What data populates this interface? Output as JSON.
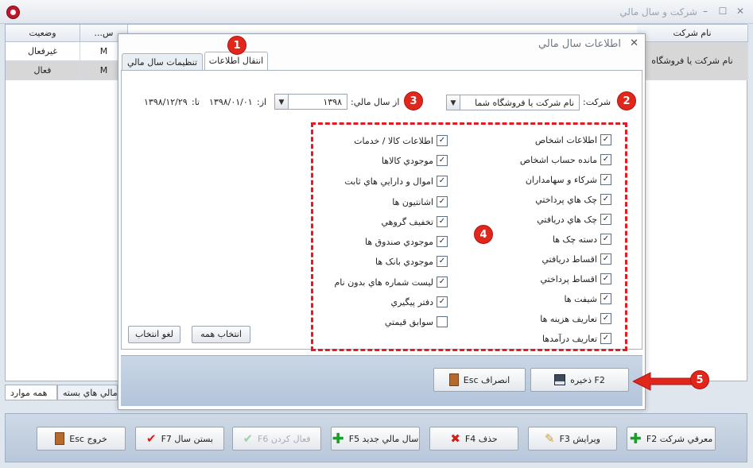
{
  "window": {
    "title": "شرکت و سال مالي"
  },
  "bg_table": {
    "headers": [
      "وضعيت",
      "...س",
      "نام شرکت"
    ],
    "rows": [
      {
        "status": "غيرفعال",
        "code": "M",
        "company": "نام شرکت يا فروشگاه"
      },
      {
        "status": "فعال",
        "code": "M",
        "company": ""
      }
    ]
  },
  "bottom_tabs": [
    "همه موارد",
    "مالي هاي بسته"
  ],
  "toolbar": {
    "introduce": "معرفي شرکت F2",
    "edit": "ويرايش F3",
    "delete": "حذف F4",
    "new_year": "سال مالي جديد F5",
    "activate": "فعال کردن F6",
    "close_year": "بستن سال F7",
    "exit": "خروج Esc"
  },
  "dialog": {
    "title": "اطلاعات سال مالي",
    "tabs": [
      "انتقال اطلاعات",
      "تنظيمات سال مالي"
    ],
    "company_label": "شرکت:",
    "company_value": "نام شرکت يا فروشگاه شما",
    "year_label": "از سال مالي:",
    "year_value": "۱۳۹۸",
    "from_label": "از:",
    "from_value": "۱۳۹۸/۰۱/۰۱",
    "to_label": "تا:",
    "to_value": "۱۳۹۸/۱۲/۲۹",
    "right_items": [
      "اطلاعات اشخاص",
      "مانده حساب اشخاص",
      "شرکاء و سهامداران",
      "چک هاي پرداختي",
      "چک هاي دريافتي",
      "دسته چک ها",
      "اقساط دريافتي",
      "اقساط پرداختي",
      "شيفت ها",
      "تعاريف هزينه ها",
      "تعاريف درآمدها"
    ],
    "left_items": [
      "اطلاعات کالا / خدمات",
      "موجودي کالاها",
      "اموال و دارايي هاي ثابت",
      "اشانتيون ها",
      "تخفيف گروهي",
      "موجودي صندوق ها",
      "موجودي بانک ها",
      "ليست شماره هاي بدون نام",
      "دفتر پيگيري",
      "سوابق قيمتي"
    ],
    "left_checked": [
      true,
      true,
      true,
      true,
      true,
      true,
      true,
      true,
      true,
      false
    ],
    "select_all": "انتخاب همه",
    "deselect_all": "لغو انتخاب",
    "save": "F2 ذخيره",
    "cancel": "انصراف Esc"
  },
  "markers": [
    "1",
    "2",
    "3",
    "4",
    "5"
  ]
}
